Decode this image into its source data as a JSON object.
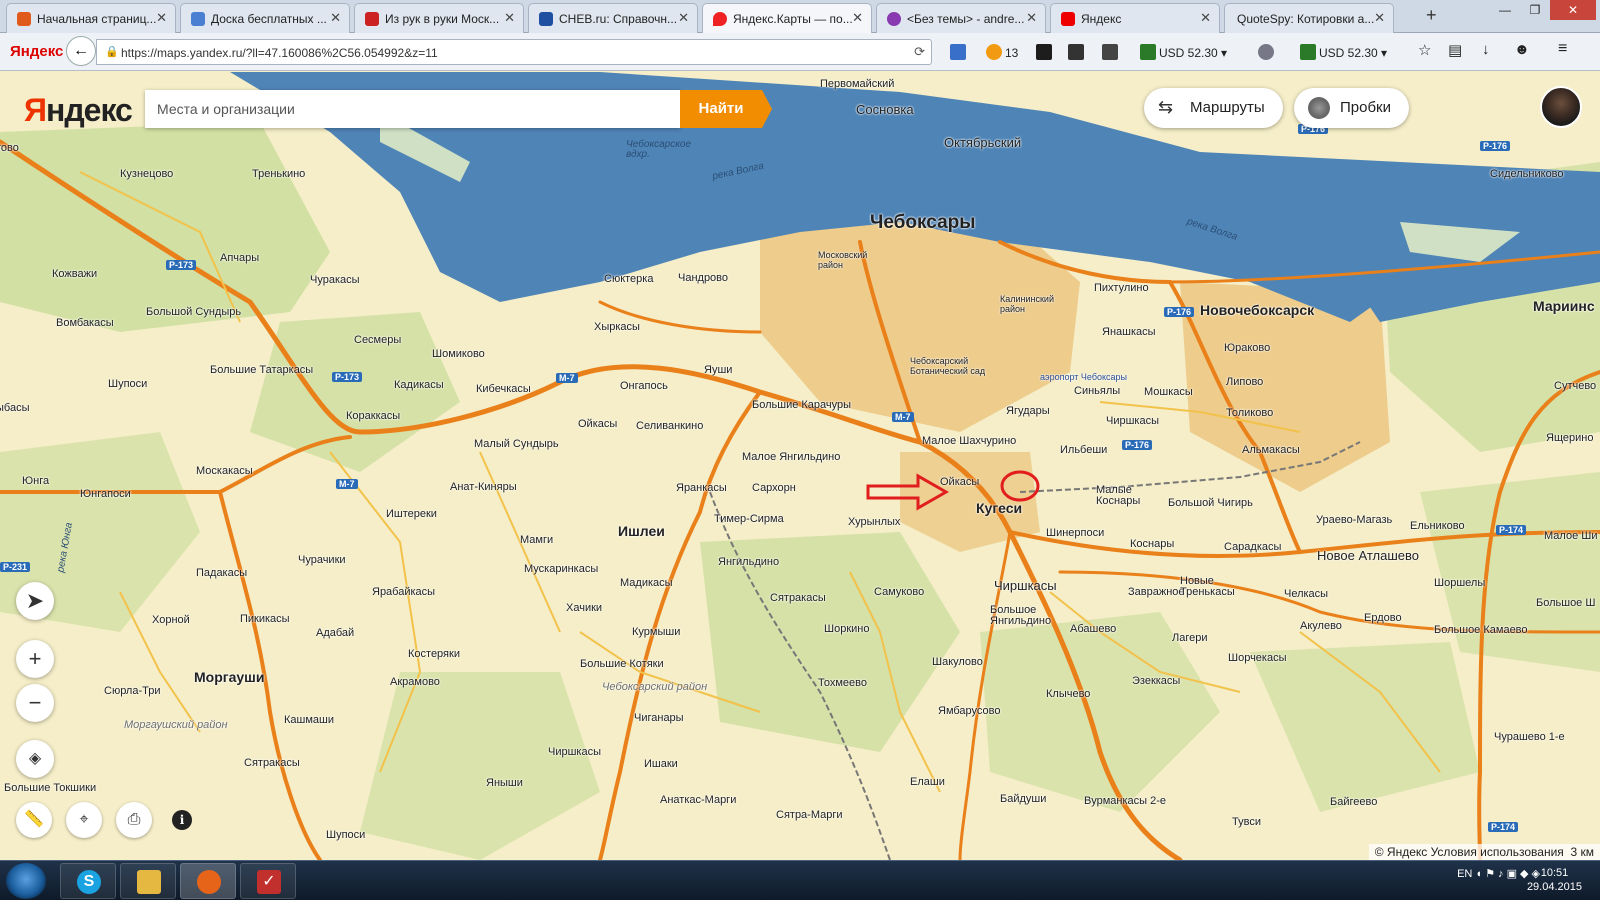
{
  "browser": {
    "tabs": [
      {
        "label": "Начальная страниц...",
        "color": "#e05a1b"
      },
      {
        "label": "Доска бесплатных ...",
        "color": "#4a7fd1"
      },
      {
        "label": "Из рук в руки Моск...",
        "color": "#c22"
      },
      {
        "label": "CHEB.ru: Справочн...",
        "color": "#1f4fa0"
      },
      {
        "label": "Яндекс.Карты — по...",
        "color": "#e22"
      },
      {
        "label": "<Без темы> - andre...",
        "color": "#8a3ab0"
      },
      {
        "label": "Яндекс",
        "color": "#e00"
      },
      {
        "label": "QuoteSpy: Котировки а...",
        "color": "#d8d8d8"
      }
    ],
    "new_tab": "+",
    "url": "https://maps.yandex.ru/?ll=47.160086%2C56.054992&z=11",
    "brand": "Яндекс",
    "ext": {
      "weather_temp": "13",
      "usd1": "USD 52.30",
      "usd2": "USD 52.30"
    }
  },
  "map_ui": {
    "logo_prefix": "Я",
    "logo_rest": "ндекс",
    "search_placeholder": "Места и организации",
    "find_button": "Найти",
    "routes_button": "Маршруты",
    "traffic_button": "Пробки",
    "copyright": "© Яндекс Условия использования",
    "scale": "3 км",
    "info": "i"
  },
  "map_labels": {
    "chebo": "Чебоксары",
    "novocheb": "Новочебоксарск",
    "kugesi": "Кугеси",
    "morgaushi": "Моргауши",
    "ishlei": "Ишлеи",
    "chirshkasy": "Чиршкасы",
    "new_atlashevo": "Новое Атлашево",
    "oktyabrsky": "Октябрьский",
    "sosnovka": "Сосновка",
    "pervomaysky": "Первомайский",
    "mariinsky": "Мариинс",
    "sidelnikovo": "Сидельниково",
    "kuzneczovo": "Кузнецово",
    "trenkino": "Тренькино",
    "aparysh": "Апчары",
    "churakasy": "Чуракасы",
    "kozhvazhi": "Кожважи",
    "b_sundyr": "Большой Сундырь",
    "vombakasy": "Вомбакасы",
    "sesmery": "Сесмеры",
    "shomikovo": "Шомиково",
    "b_tatarkasy": "Большие Татаркасы",
    "kadikasy": "Кадикасы",
    "kibechkasy": "Кибечкасы",
    "shuposy": "Шупоси",
    "korakkasy": "Кораккасы",
    "m_sundyr": "Малый Сундырь",
    "moskakasy": "Москакасы",
    "yunga": "Юнга",
    "yungaposy": "Юнгапоси",
    "anat_kinyary": "Анат-Киняры",
    "ishtereki": "Иштереки",
    "churachiki": "Чурачики",
    "mamgi": "Мамги",
    "padakasy": "Падакасы",
    "yarabaykasy": "Ярабайкасы",
    "muskarinkasy": "Мускаринкасы",
    "hachiki": "Хачики",
    "madikasy": "Мадикасы",
    "horpol": "Хорной",
    "pikikasy": "Пикикасы",
    "adabay": "Адабай",
    "kosteryaki": "Костеряки",
    "akramovo": "Акрамово",
    "syurla_tri": "Сюрла-Три",
    "kashmashi": "Кашмаши",
    "morgaush_rayon": "Моргаушский район",
    "syatrakasy_w": "Сятракасы",
    "b_toksh": "Большие Токшики",
    "shuposy_s": "Шупоси",
    "sunkasy": "Сюктерка",
    "chandrovo": "Чандрово",
    "hyrkasy": "Хыркасы",
    "ongapos": "Онгапось",
    "yaushi": "Яуши",
    "b_karachury": "Большие Карачуры",
    "seliv": "Селиванкино",
    "oykasy_w": "Ойкасы",
    "m_yangil": "Малое Янгильдино",
    "sarhorn": "Сархорн",
    "yarankasy": "Яранкасы",
    "timer_sirma": "Тимер-Сирма",
    "hurynlykh": "Хурынлых",
    "yangildino": "Янгильдино",
    "syatrakasy_c": "Сятракасы",
    "samukovo": "Самуково",
    "kurmyshi": "Курмыши",
    "shorkino": "Шоркино",
    "b_kotyaki": "Большие Котяки",
    "cheb_rayon": "Чебоксарский район",
    "tohmeevo": "Тохмеево",
    "shakulovo": "Шакулово",
    "chigany": "Чиганары",
    "ishaki": "Ишаки",
    "yambarusovo": "Ямбарусово",
    "yanyshi": "Яныши",
    "chirshkasy_s": "Чиршкасы",
    "anatkas": "Анаткас-Марги",
    "syatra_margi": "Сятра-Марги",
    "elashi": "Елаши",
    "bayduši": "Байдуши",
    "vurmankasy": "Вурманкасы 2-е",
    "tuvsi": "Тувси",
    "baygeevo": "Байгеево",
    "moscow_rayon": "Московский район",
    "kalinin_rayon": "Калининский район",
    "bot_sad": "Чебоксарский Ботанический сад",
    "airport": "аэропорт Чебоксары",
    "pikhtulino": "Пихтулино",
    "yanashkasy": "Янашкасы",
    "yurakovo": "Юраково",
    "lipovo": "Липово",
    "toliskovo": "Толиково",
    "almakasy": "Альмакасы",
    "ilbeshi": "Ильбеши",
    "sinyaly": "Синьялы",
    "moshkasy": "Мошкасы",
    "chirshkasy_n": "Чиршкасы",
    "yagudary": "Ягудары",
    "m_shahchurino": "Малое Шахчурино",
    "oykasy_c": "Ойкасы",
    "m_kosnary": "Малые Коснары",
    "b_chigir": "Большой Чигирь",
    "urayevo": "Ураево-Магазь",
    "elnikovo": "Ельниково",
    "m_shigr": "Малое Ши",
    "shinerposi": "Шинерпоси",
    "kosnary": "Коснары",
    "saradkasy": "Сарадкасы",
    "zavrazhnoe": "Завражное",
    "n_trenkasy": "Новые Тренькасы",
    "chelkasy": "Челкасы",
    "shorshely": "Шоршелы",
    "b_yangil": "Большое Янгильдино",
    "abashevo": "Абашево",
    "lageri": "Лагери",
    "akulevo": "Акулево",
    "erdovo": "Ердово",
    "b_kamaevo": "Большое Камаево",
    "b_shigr": "Большое Ш",
    "shorchekasy": "Шорчекасы",
    "klychevo": "Клычево",
    "ezekkasy": "Эзеккасы",
    "churashevo": "Чурашево 1-е",
    "yashcherino": "Ящерино",
    "sutchevo": "Сутчево",
    "cheb_vodohr": "Чебоксарское вдхр.",
    "volga1": "река Волга",
    "volga2": "река Волга",
    "yunga_river": "река Юнга",
    "tovo": "тово",
    "ybasy": "ыбасы"
  },
  "road_shields": [
    "P-173",
    "P-173",
    "M-7",
    "M-7",
    "M-7",
    "P-176",
    "P-176",
    "P-176",
    "P-174",
    "P-174",
    "P-231",
    "P-176"
  ],
  "taskbar": {
    "time": "10:51",
    "date": "29.04.2015",
    "lang": "EN"
  }
}
